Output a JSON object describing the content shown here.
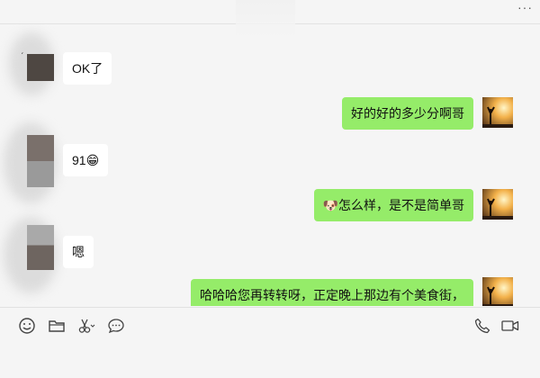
{
  "header": {
    "more_label": "···"
  },
  "messages": [
    {
      "side": "left",
      "text": "OK了"
    },
    {
      "side": "right",
      "text": "好的好的多少分啊哥"
    },
    {
      "side": "left",
      "text": "91",
      "emoji": "😁"
    },
    {
      "side": "right",
      "text": "怎么样，是不是简单哥",
      "emoji": "🐶"
    },
    {
      "side": "left",
      "text": "嗯"
    },
    {
      "side": "right",
      "text": "哈哈哈您再转转呀，正定晚上那边有个美食街，"
    }
  ],
  "toolbar": {
    "left_icons": [
      "emoji-icon",
      "folder-icon",
      "scissors-icon",
      "chat-history-icon"
    ],
    "right_icons": [
      "phone-icon",
      "video-call-icon"
    ]
  },
  "colors": {
    "bubble_sent": "#95ec69",
    "bubble_received": "#ffffff",
    "background": "#f5f5f5"
  }
}
